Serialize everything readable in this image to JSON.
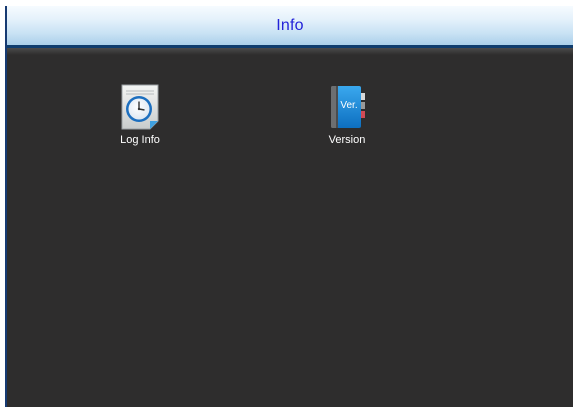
{
  "header": {
    "title": "Info"
  },
  "apps": [
    {
      "label": "Log Info",
      "icon": "clock-document-icon"
    },
    {
      "label": "Version",
      "icon": "version-book-icon",
      "badge": "Ver."
    }
  ],
  "colors": {
    "title_text": "#2323d8",
    "background": "#2e2d2d",
    "header_border": "#0f3d6e"
  }
}
